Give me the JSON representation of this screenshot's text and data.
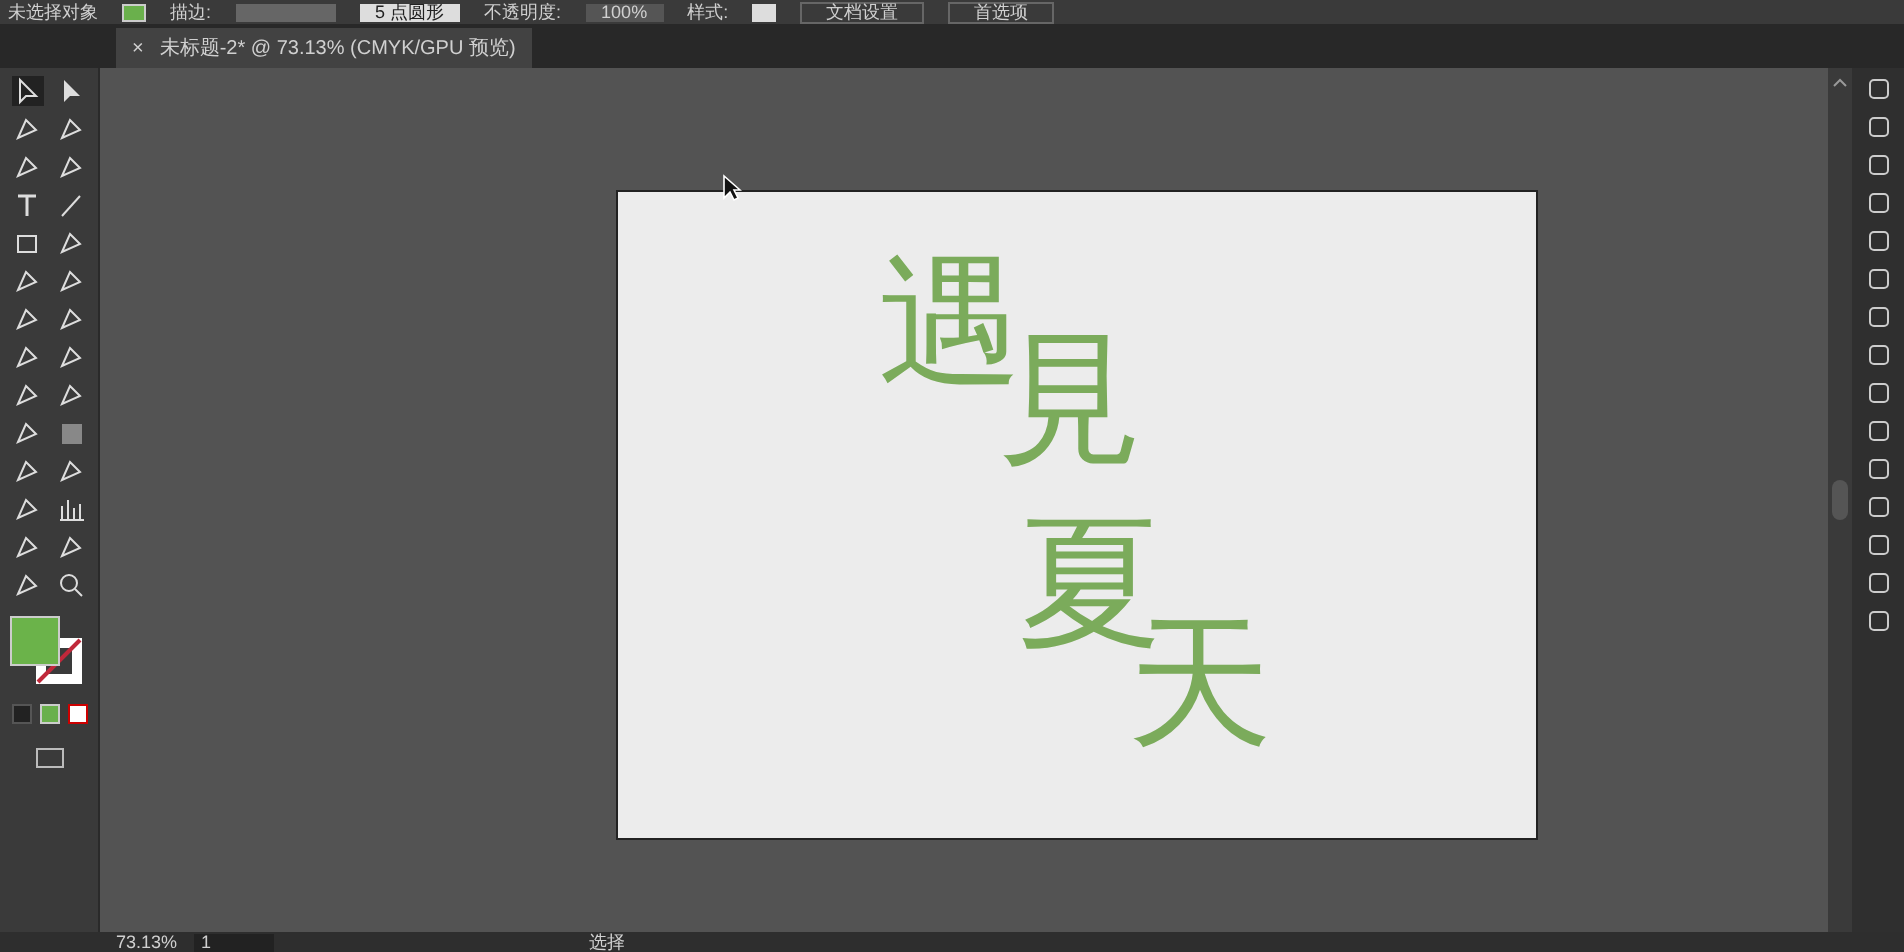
{
  "control_bar": {
    "selection": "未选择对象",
    "stroke_label": "描边:",
    "brush": "5 点圆形",
    "opacity_label": "不透明度:",
    "opacity": "100%",
    "style_label": "样式:",
    "buttons": [
      "文档设置",
      "首选项"
    ]
  },
  "document_tab": {
    "close": "×",
    "title": "未标题-2* @ 73.13% (CMYK/GPU 预览)"
  },
  "artboard": {
    "artwork": [
      {
        "text": "遇"
      },
      {
        "text": "見"
      },
      {
        "text": "夏"
      },
      {
        "text": "天"
      }
    ]
  },
  "status_bar": {
    "zoom": "73.13%",
    "artboard": "1",
    "tool": "选择"
  }
}
